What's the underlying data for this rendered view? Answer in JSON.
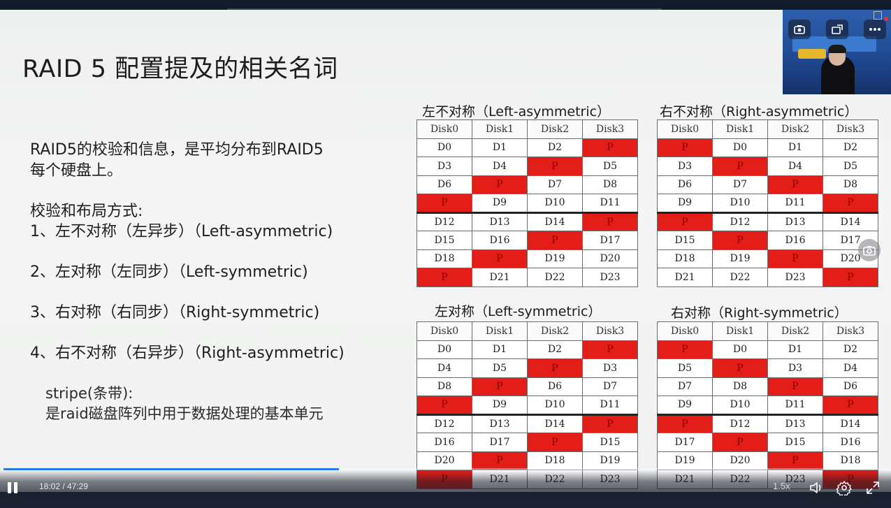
{
  "slide": {
    "title": "RAID 5 配置提及的相关名词",
    "intro_line1": "RAID5的校验和信息，是平均分布到RAID5",
    "intro_line2": "每个硬盘上。",
    "layout_heading": "校验和布局方式:",
    "methods": [
      "1、左不对称（左异步）（Left-asymmetric)",
      "2、左对称（左同步）（Left-symmetric)",
      "3、右对称（右同步）（Right-symmetric)",
      "4、右不对称（右异步）（Right-asymmetric)"
    ],
    "stripe_label": "stripe(条带):",
    "stripe_desc": "是raid磁盘阵列中用于数据处理的基本单元"
  },
  "tables": [
    {
      "title": "左不对称（Left-asymmetric）",
      "headers": [
        "Disk0",
        "Disk1",
        "Disk2",
        "Disk3"
      ],
      "rows": [
        [
          "D0",
          "D1",
          "D2",
          "P"
        ],
        [
          "D3",
          "D4",
          "P",
          "D5"
        ],
        [
          "D6",
          "P",
          "D7",
          "D8"
        ],
        [
          "P",
          "D9",
          "D10",
          "D11"
        ],
        [
          "D12",
          "D13",
          "D14",
          "P"
        ],
        [
          "D15",
          "D16",
          "P",
          "D17"
        ],
        [
          "D18",
          "P",
          "D19",
          "D20"
        ],
        [
          "P",
          "D21",
          "D22",
          "D23"
        ]
      ]
    },
    {
      "title": "右不对称（Right-asymmetric）",
      "headers": [
        "Disk0",
        "Disk1",
        "Disk2",
        "Disk3"
      ],
      "rows": [
        [
          "P",
          "D0",
          "D1",
          "D2"
        ],
        [
          "D3",
          "P",
          "D4",
          "D5"
        ],
        [
          "D6",
          "D7",
          "P",
          "D8"
        ],
        [
          "D9",
          "D10",
          "D11",
          "P"
        ],
        [
          "P",
          "D12",
          "D13",
          "D14"
        ],
        [
          "D15",
          "P",
          "D16",
          "D17"
        ],
        [
          "D18",
          "D19",
          "P",
          "D20"
        ],
        [
          "D21",
          "D22",
          "D23",
          "P"
        ]
      ]
    },
    {
      "title": "左对称（Left-symmetric）",
      "headers": [
        "Disk0",
        "Disk1",
        "Disk2",
        "Disk3"
      ],
      "rows": [
        [
          "D0",
          "D1",
          "D2",
          "P"
        ],
        [
          "D4",
          "D5",
          "P",
          "D3"
        ],
        [
          "D8",
          "P",
          "D6",
          "D7"
        ],
        [
          "P",
          "D9",
          "D10",
          "D11"
        ],
        [
          "D12",
          "D13",
          "D14",
          "P"
        ],
        [
          "D16",
          "D17",
          "P",
          "D15"
        ],
        [
          "D20",
          "P",
          "D18",
          "D19"
        ],
        [
          "P",
          "D21",
          "D22",
          "D23"
        ]
      ]
    },
    {
      "title": "右对称（Right-symmetric）",
      "headers": [
        "Disk0",
        "Disk1",
        "Disk2",
        "Disk3"
      ],
      "rows": [
        [
          "P",
          "D0",
          "D1",
          "D2"
        ],
        [
          "D5",
          "P",
          "D3",
          "D4"
        ],
        [
          "D7",
          "D8",
          "P",
          "D6"
        ],
        [
          "D9",
          "D10",
          "D11",
          "P"
        ],
        [
          "P",
          "D12",
          "D13",
          "D14"
        ],
        [
          "D17",
          "P",
          "D15",
          "D16"
        ],
        [
          "D19",
          "D20",
          "P",
          "D18"
        ],
        [
          "D21",
          "D22",
          "D23",
          "P"
        ]
      ]
    }
  ],
  "player": {
    "time_display": "18:02 / 47:29",
    "progress": 0.3797,
    "speed": "1.5x",
    "colors": {
      "progress": "#2a7be4",
      "parity": "#e31d18"
    },
    "icons": {
      "pause": "pause-icon",
      "volume": "volume-icon",
      "settings": "gear-icon",
      "fullscreen": "fullscreen-icon",
      "screenshot": "camera-icon",
      "cam_switch": "camera-switch-icon",
      "popout": "popout-icon",
      "more": "more-icon"
    }
  }
}
